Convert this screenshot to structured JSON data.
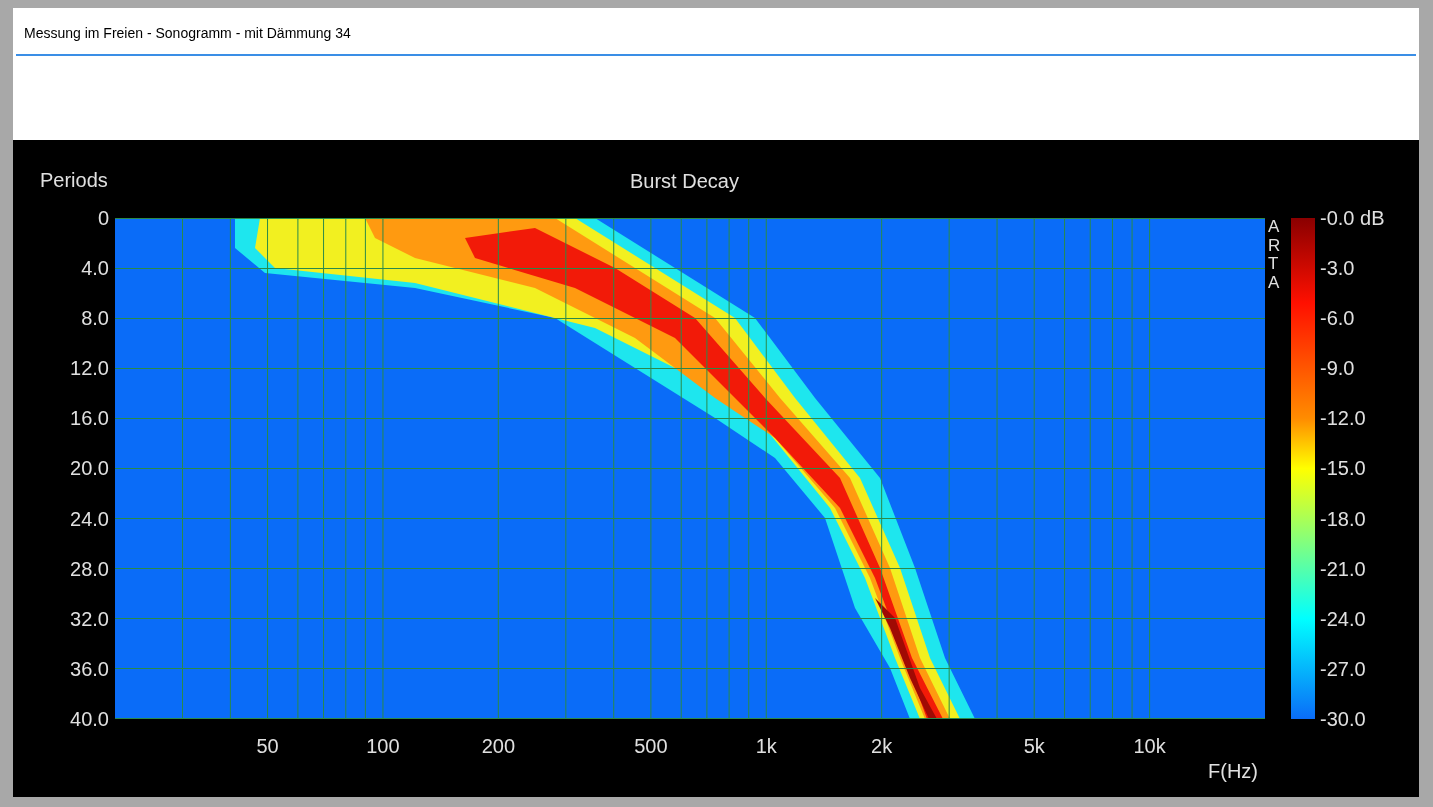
{
  "window": {
    "title": "Messung im Freien - Sonogramm - mit Dämmung 34"
  },
  "chart": {
    "title": "Burst Decay",
    "y_axis_title": "Periods",
    "x_axis_title": "F(Hz)",
    "y_ticks": [
      "0",
      "4.0",
      "8.0",
      "12.0",
      "16.0",
      "20.0",
      "24.0",
      "28.0",
      "32.0",
      "36.0",
      "40.0"
    ],
    "x_ticks": [
      "50",
      "100",
      "200",
      "500",
      "1k",
      "2k",
      "5k",
      "10k"
    ],
    "side_label": "ARTA"
  },
  "color_scale": {
    "labels": [
      "-0.0 dB",
      "-3.0",
      "-6.0",
      "-9.0",
      "-12.0",
      "-15.0",
      "-18.0",
      "-21.0",
      "-24.0",
      "-27.0",
      "-30.0"
    ]
  }
}
